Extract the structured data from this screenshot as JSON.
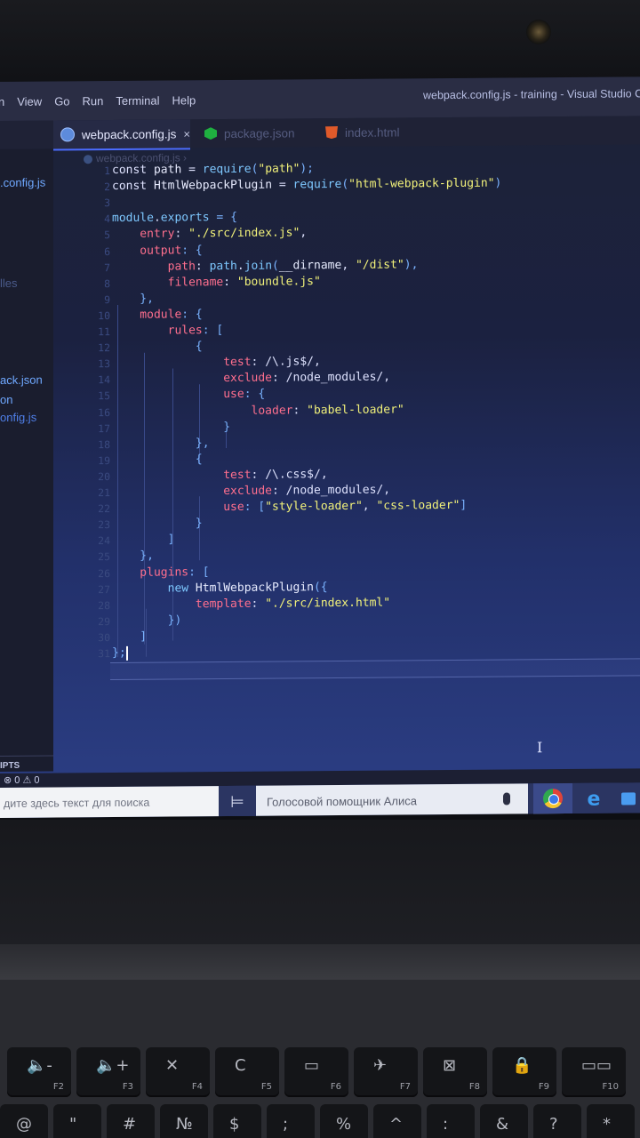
{
  "window": {
    "title": "webpack.config.js - training - Visual Studio Co"
  },
  "menu": [
    "n",
    "View",
    "Go",
    "Run",
    "Terminal",
    "Help"
  ],
  "tabs": [
    {
      "label": "webpack.config.js",
      "close": "×",
      "icon": "webpack-icon",
      "active": true
    },
    {
      "label": "package.json",
      "icon": "npm-icon",
      "active": false
    },
    {
      "label": "index.html",
      "icon": "html5-icon",
      "active": false
    }
  ],
  "breadcrumb": "webpack.config.js ›",
  "sidebar": {
    "items": [
      {
        "label": ".config.js",
        "style": "normal"
      },
      {
        "label": "lles",
        "style": "dim"
      },
      {
        "label": "ack.json",
        "style": "normal"
      },
      {
        "label": "on",
        "style": "normal"
      },
      {
        "label": "onfig.js",
        "style": "strong"
      }
    ],
    "section": "IPTS"
  },
  "code": {
    "line_numbers": [
      "1",
      "2",
      "3",
      "4",
      "5",
      "6",
      "7",
      "8",
      "9",
      "10",
      "11",
      "12",
      "13",
      "14",
      "15",
      "16",
      "17",
      "18",
      "19",
      "20",
      "21",
      "22",
      "23",
      "24",
      "25",
      "26",
      "27",
      "28",
      "29",
      "30",
      "31"
    ],
    "lines": [
      [
        {
          "t": "const ",
          "c": "kw"
        },
        {
          "t": "path",
          "c": "cls"
        },
        {
          "t": " = ",
          "c": "kw"
        },
        {
          "t": "require",
          "c": "fn"
        },
        {
          "t": "(",
          "c": "punc"
        },
        {
          "t": "\"path\"",
          "c": "str"
        },
        {
          "t": ");",
          "c": "punc"
        }
      ],
      [
        {
          "t": "const ",
          "c": "kw"
        },
        {
          "t": "HtmlWebpackPlugin",
          "c": "cls"
        },
        {
          "t": " = ",
          "c": "kw"
        },
        {
          "t": "require",
          "c": "fn"
        },
        {
          "t": "(",
          "c": "punc"
        },
        {
          "t": "\"html-webpack-plugin\"",
          "c": "str"
        },
        {
          "t": ")",
          "c": "punc"
        }
      ],
      [],
      [
        {
          "t": "module",
          "c": "fn"
        },
        {
          "t": ".",
          "c": "kw"
        },
        {
          "t": "exports",
          "c": "fn"
        },
        {
          "t": " = {",
          "c": "punc"
        }
      ],
      [
        {
          "t": "    entry",
          "c": "prop"
        },
        {
          "t": ": ",
          "c": "kw"
        },
        {
          "t": "\"./src/index.js\"",
          "c": "str"
        },
        {
          "t": ",",
          "c": "kw"
        }
      ],
      [
        {
          "t": "    output",
          "c": "prop"
        },
        {
          "t": ": {",
          "c": "punc"
        }
      ],
      [
        {
          "t": "        path",
          "c": "prop"
        },
        {
          "t": ": ",
          "c": "kw"
        },
        {
          "t": "path",
          "c": "fn"
        },
        {
          "t": ".",
          "c": "kw"
        },
        {
          "t": "join",
          "c": "fn"
        },
        {
          "t": "(",
          "c": "punc"
        },
        {
          "t": "__dirname",
          "c": "cls"
        },
        {
          "t": ", ",
          "c": "kw"
        },
        {
          "t": "\"/dist\"",
          "c": "str"
        },
        {
          "t": "),",
          "c": "punc"
        }
      ],
      [
        {
          "t": "        filename",
          "c": "prop"
        },
        {
          "t": ": ",
          "c": "kw"
        },
        {
          "t": "\"boundle.js\"",
          "c": "str"
        }
      ],
      [
        {
          "t": "    },",
          "c": "punc"
        }
      ],
      [
        {
          "t": "    module",
          "c": "prop"
        },
        {
          "t": ": {",
          "c": "punc"
        }
      ],
      [
        {
          "t": "        rules",
          "c": "prop"
        },
        {
          "t": ": [",
          "c": "punc"
        }
      ],
      [
        {
          "t": "            {",
          "c": "punc"
        }
      ],
      [
        {
          "t": "                test",
          "c": "prop"
        },
        {
          "t": ": /\\.js$/",
          "c": "kw"
        },
        {
          "t": ",",
          "c": "kw"
        }
      ],
      [
        {
          "t": "                exclude",
          "c": "prop"
        },
        {
          "t": ": /node_modules/,",
          "c": "kw"
        }
      ],
      [
        {
          "t": "                use",
          "c": "prop"
        },
        {
          "t": ": {",
          "c": "punc"
        }
      ],
      [
        {
          "t": "                    loader",
          "c": "prop"
        },
        {
          "t": ": ",
          "c": "kw"
        },
        {
          "t": "\"babel-loader\"",
          "c": "str"
        }
      ],
      [
        {
          "t": "                }",
          "c": "punc"
        }
      ],
      [
        {
          "t": "            },",
          "c": "punc"
        }
      ],
      [
        {
          "t": "            {",
          "c": "punc"
        }
      ],
      [
        {
          "t": "                test",
          "c": "prop"
        },
        {
          "t": ": /\\.css$/",
          "c": "kw"
        },
        {
          "t": ",",
          "c": "kw"
        }
      ],
      [
        {
          "t": "                exclude",
          "c": "prop"
        },
        {
          "t": ": /node_modules/,",
          "c": "kw"
        }
      ],
      [
        {
          "t": "                use",
          "c": "prop"
        },
        {
          "t": ": [",
          "c": "punc"
        },
        {
          "t": "\"style-loader\"",
          "c": "str"
        },
        {
          "t": ", ",
          "c": "kw"
        },
        {
          "t": "\"css-loader\"",
          "c": "str"
        },
        {
          "t": "]",
          "c": "punc"
        }
      ],
      [
        {
          "t": "            }",
          "c": "punc"
        }
      ],
      [
        {
          "t": "        ]",
          "c": "punc"
        }
      ],
      [
        {
          "t": "    },",
          "c": "punc"
        }
      ],
      [
        {
          "t": "    plugins",
          "c": "prop"
        },
        {
          "t": ": [",
          "c": "punc"
        }
      ],
      [
        {
          "t": "        new ",
          "c": "fn"
        },
        {
          "t": "HtmlWebpackPlugin",
          "c": "cls"
        },
        {
          "t": "({",
          "c": "punc"
        }
      ],
      [
        {
          "t": "            template",
          "c": "prop"
        },
        {
          "t": ": ",
          "c": "kw"
        },
        {
          "t": "\"./src/index.html\"",
          "c": "str"
        }
      ],
      [
        {
          "t": "        })",
          "c": "punc"
        }
      ],
      [
        {
          "t": "    ]",
          "c": "punc"
        }
      ],
      [
        {
          "t": "};",
          "c": "punc"
        }
      ]
    ]
  },
  "statusbar": {
    "problems": "⊗ 0 ⚠ 0"
  },
  "taskbar": {
    "search_placeholder": "дите здесь текст для поиска",
    "taskview": "⊨",
    "alice_placeholder": "Голосовой помощник Алиса",
    "edge_glyph": "e"
  },
  "keyboard": {
    "fkeys": [
      {
        "glyph": "🔈-",
        "label": "F2"
      },
      {
        "glyph": "🔈+",
        "label": "F3"
      },
      {
        "glyph": "✕",
        "label": "F4"
      },
      {
        "glyph": "C",
        "label": "F5"
      },
      {
        "glyph": "▭",
        "label": "F6"
      },
      {
        "glyph": "✈",
        "label": "F7"
      },
      {
        "glyph": "⊠",
        "label": "F8"
      },
      {
        "glyph": "🔒",
        "label": "F9"
      },
      {
        "glyph": "▭▭",
        "label": "F10"
      }
    ],
    "numrow": [
      "@",
      "\"",
      "#",
      "№",
      "$",
      ";",
      "%",
      "^",
      ":",
      "&",
      "?",
      "*"
    ]
  },
  "colors": {
    "accent": "#4b6cff",
    "property": "#ff6f8e",
    "string": "#f2f27a",
    "function": "#7ec8ff"
  }
}
